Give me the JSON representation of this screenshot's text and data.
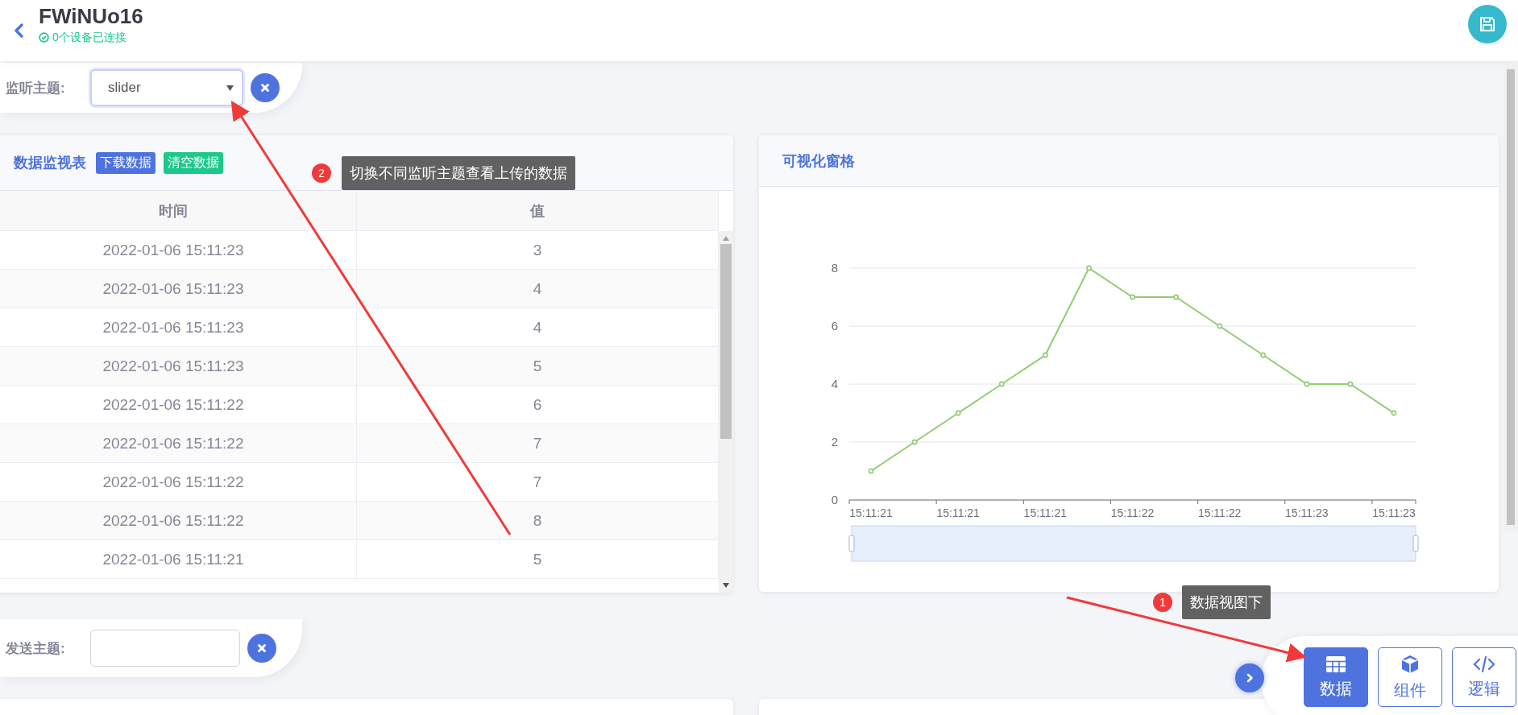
{
  "header": {
    "title": "FWiNUo16",
    "status": "0个设备已连接"
  },
  "listen_topic": {
    "label": "监听主题:",
    "value": "slider"
  },
  "monitor_table": {
    "title": "数据监视表",
    "buttons": [
      {
        "label": "下载数据",
        "kind": "download"
      },
      {
        "label": "清空数据",
        "kind": "clear"
      }
    ],
    "columns": [
      "时间",
      "值"
    ],
    "rows": [
      [
        "2022-01-06 15:11:23",
        "3"
      ],
      [
        "2022-01-06 15:11:23",
        "4"
      ],
      [
        "2022-01-06 15:11:23",
        "4"
      ],
      [
        "2022-01-06 15:11:23",
        "5"
      ],
      [
        "2022-01-06 15:11:22",
        "6"
      ],
      [
        "2022-01-06 15:11:22",
        "7"
      ],
      [
        "2022-01-06 15:11:22",
        "7"
      ],
      [
        "2022-01-06 15:11:22",
        "8"
      ],
      [
        "2022-01-06 15:11:21",
        "5"
      ]
    ]
  },
  "visual_panel": {
    "title": "可视化窗格",
    "chart_data": {
      "type": "line",
      "categories": [
        "15:11:21",
        null,
        "15:11:21",
        null,
        "15:11:21",
        null,
        "15:11:22",
        null,
        "15:11:22",
        null,
        "15:11:23",
        null,
        "15:11:23"
      ],
      "series": [
        {
          "color": "#91cc75",
          "marker": "circle",
          "values": [
            1,
            2,
            3,
            4,
            5,
            8,
            7,
            7,
            6,
            5,
            4,
            4,
            3
          ]
        }
      ],
      "ylim": [
        0,
        8
      ],
      "yticks": [
        0,
        2,
        4,
        6,
        8
      ],
      "grid": true
    }
  },
  "send_topic": {
    "label": "发送主题:"
  },
  "view_tabs": [
    {
      "label": "数据",
      "kind": "table",
      "selected": true
    },
    {
      "label": "组件",
      "kind": "cube",
      "selected": false
    },
    {
      "label": "逻辑",
      "kind": "code",
      "selected": false
    }
  ],
  "annotations": [
    {
      "number": "2",
      "text": "切换不同监听主题查看上传的数据"
    },
    {
      "number": "1",
      "text": "数据视图下"
    }
  ]
}
